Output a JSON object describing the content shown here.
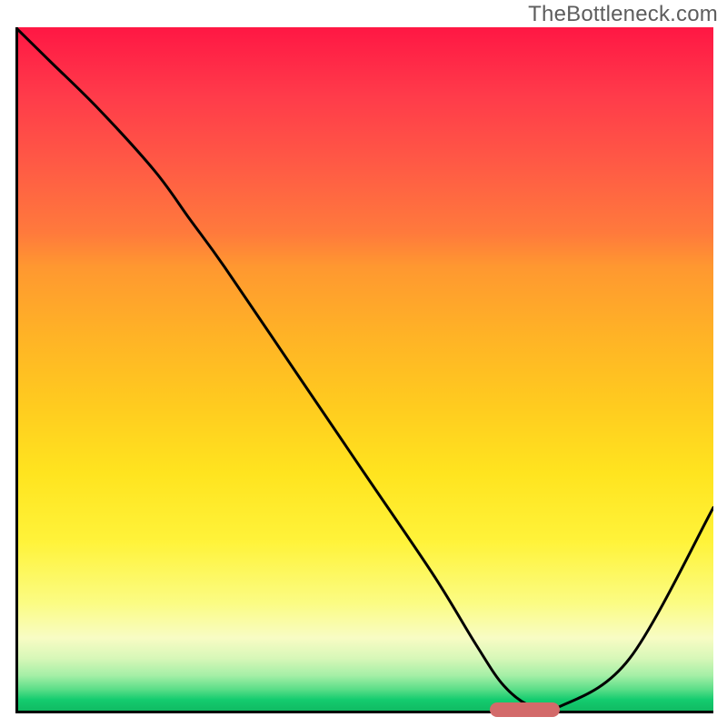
{
  "watermark": "TheBottleneck.com",
  "colors": {
    "gradient_top": "#ff1744",
    "gradient_mid": "#ffcb1f",
    "gradient_bottom": "#0fb65f",
    "axis": "#000000",
    "curve": "#000000",
    "marker": "#d36a6a"
  },
  "chart_data": {
    "type": "line",
    "title": "",
    "xlabel": "",
    "ylabel": "",
    "xlim": [
      0,
      100
    ],
    "ylim": [
      0,
      100
    ],
    "x": [
      0,
      5,
      12,
      20,
      25,
      30,
      40,
      50,
      60,
      66,
      70,
      74,
      78,
      88,
      100
    ],
    "values": [
      100,
      95,
      88,
      79,
      72,
      65,
      50,
      35,
      20,
      10,
      4,
      1,
      1,
      8,
      30
    ],
    "annotations": [],
    "marker": {
      "x_start": 68,
      "x_end": 78,
      "y": 0.5
    }
  }
}
